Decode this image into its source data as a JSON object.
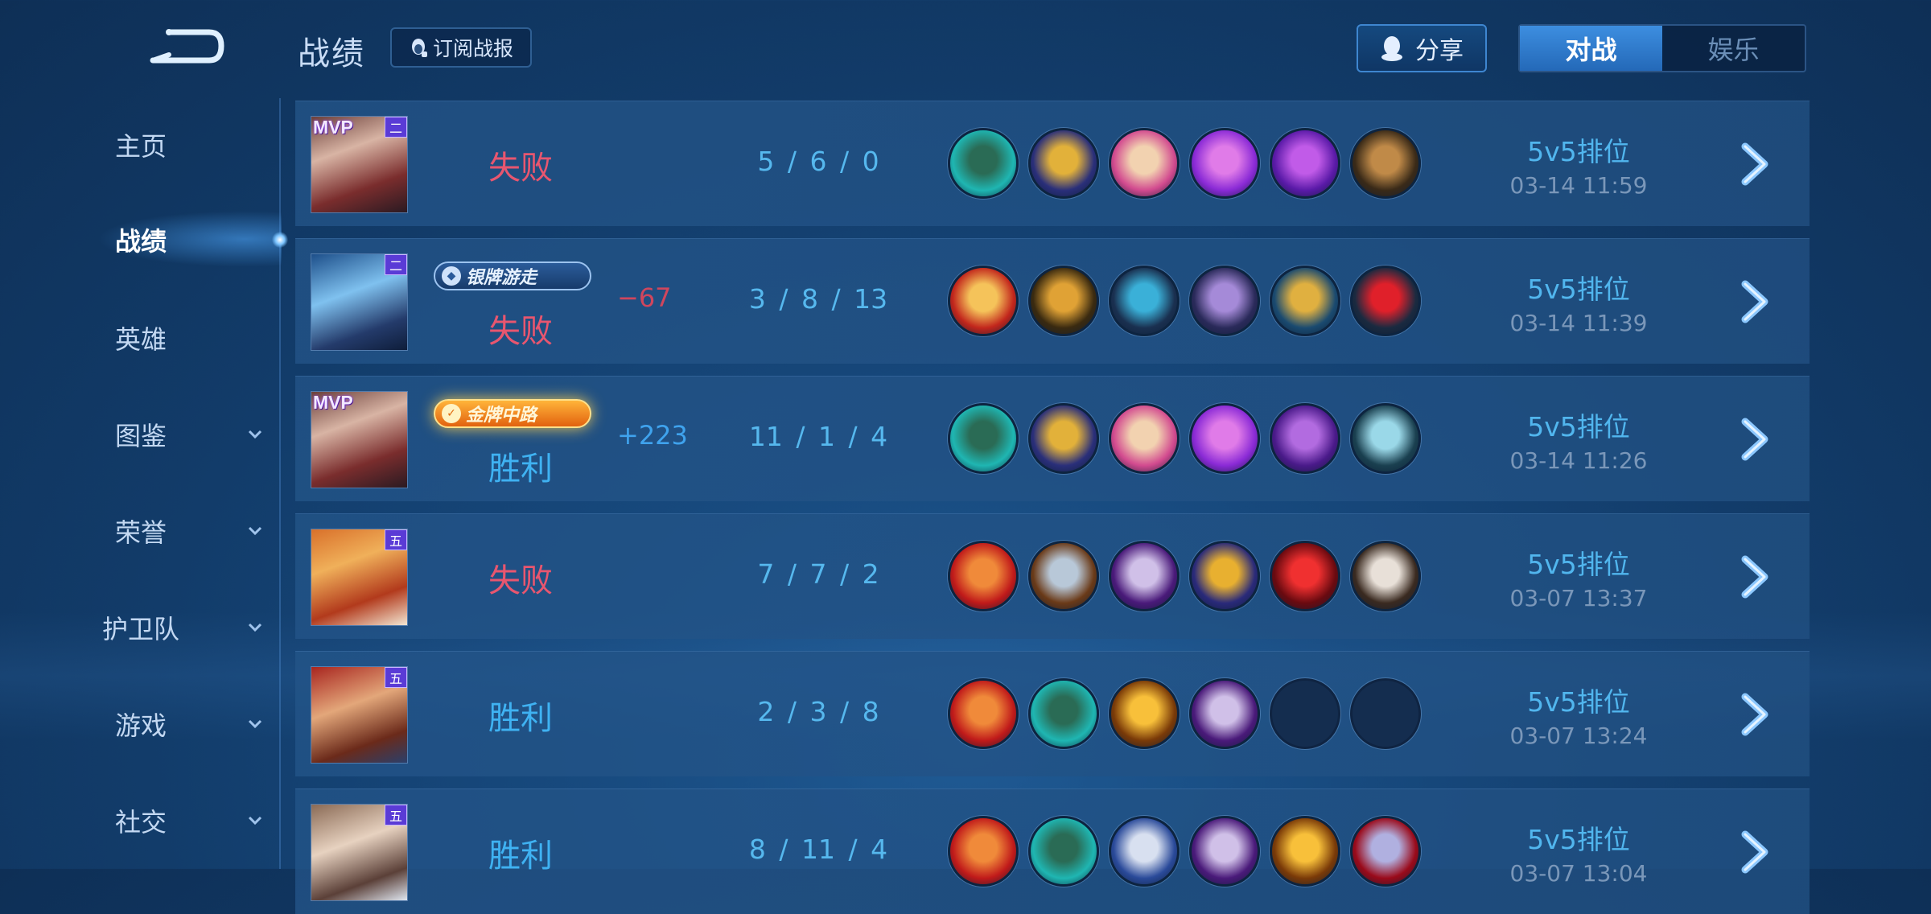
{
  "header": {
    "title": "战绩",
    "subscribe_label": "订阅战报",
    "share_label": "分享",
    "tabs": [
      {
        "label": "对战",
        "active": true
      },
      {
        "label": "娱乐",
        "active": false
      }
    ]
  },
  "sidebar": {
    "items": [
      {
        "label": "主页"
      },
      {
        "label": "战绩",
        "active": true
      },
      {
        "label": "英雄"
      },
      {
        "label": "图鉴",
        "expandable": true
      },
      {
        "label": "荣誉",
        "expandable": true
      },
      {
        "label": "护卫队",
        "expandable": true
      },
      {
        "label": "游戏",
        "expandable": true
      },
      {
        "label": "社交",
        "expandable": true
      }
    ]
  },
  "colors": {
    "win": "#3fb2f2",
    "loss": "#e8566f",
    "accent": "#3d8ee0"
  },
  "matches": [
    {
      "mvp_label": "MVP",
      "rank_badge": "二",
      "result": "失败",
      "outcome": "loss",
      "medal": "",
      "delta": "",
      "kda": "5 / 6 / 0",
      "items": [
        "boots-item",
        "chalice-item",
        "tome-item",
        "purple-cloak-item",
        "purple-scepter-item",
        "wooden-shield-item"
      ],
      "mode": "5v5排位",
      "time": "03-14  11:59"
    },
    {
      "mvp_label": "",
      "rank_badge": "二",
      "result": "失败",
      "outcome": "loss",
      "medal": "银牌游走",
      "medal_type": "silver",
      "delta": "−67",
      "kda": "3 / 8 / 13",
      "items": [
        "flame-wing-item",
        "gold-armor-item",
        "dark-armor-item",
        "purple-armor-item",
        "gold-shield-item",
        "red-gem-item"
      ],
      "mode": "5v5排位",
      "time": "03-14  11:39"
    },
    {
      "mvp_label": "MVP",
      "rank_badge": "",
      "result": "胜利",
      "outcome": "win",
      "medal": "金牌中路",
      "medal_type": "gold",
      "delta": "+223",
      "kda": "11 / 1 / 4",
      "items": [
        "boots-item",
        "chalice-item",
        "tome-item",
        "purple-cloak-item",
        "purple-staff-item",
        "silver-belt-item"
      ],
      "mode": "5v5排位",
      "time": "03-14  11:26"
    },
    {
      "mvp_label": "",
      "rank_badge": "五",
      "result": "失败",
      "outcome": "loss",
      "medal": "",
      "delta": "",
      "kda": "7 / 7 / 2",
      "items": [
        "red-axe-item",
        "steel-boots-item",
        "purple-axe-item",
        "gold-cross-item",
        "red-orb-item",
        "white-armor-item"
      ],
      "mode": "5v5排位",
      "time": "03-07  13:37"
    },
    {
      "mvp_label": "",
      "rank_badge": "五",
      "result": "胜利",
      "outcome": "win",
      "medal": "",
      "delta": "",
      "kda": "2 / 3 / 8",
      "items": [
        "red-axe-item",
        "boots-item",
        "gold-sword-item",
        "purple-axe-item",
        "empty-slot",
        "empty-slot"
      ],
      "mode": "5v5排位",
      "time": "03-07  13:24"
    },
    {
      "mvp_label": "",
      "rank_badge": "五",
      "result": "胜利",
      "outcome": "win",
      "medal": "",
      "delta": "",
      "kda": "8 / 11 / 4",
      "items": [
        "red-axe-item",
        "boots-item",
        "blue-axe-item",
        "purple-axe-item",
        "gold-sword-item",
        "crimson-armor-item"
      ],
      "mode": "5v5排位",
      "time": "03-07  13:04"
    }
  ]
}
